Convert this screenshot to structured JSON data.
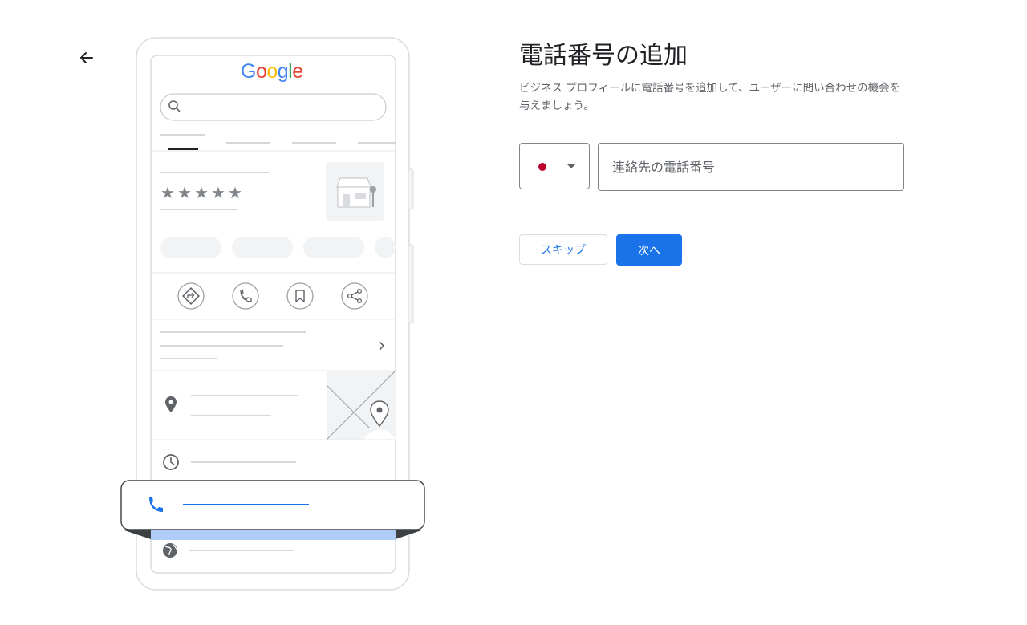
{
  "illustration": {
    "logo_letters": [
      {
        "char": "G",
        "color": "#4285F4"
      },
      {
        "char": "o",
        "color": "#EA4335"
      },
      {
        "char": "o",
        "color": "#FBBC05"
      },
      {
        "char": "g",
        "color": "#4285F4"
      },
      {
        "char": "l",
        "color": "#34A853"
      },
      {
        "char": "e",
        "color": "#EA4335"
      }
    ],
    "star_rating": 5,
    "highlight_color": "#1a73e8"
  },
  "header": {
    "title": "電話番号の追加",
    "description": "ビジネス プロフィールに電話番号を追加して、ユーザーに問い合わせの機会を与えましょう。"
  },
  "form": {
    "country_flag_color": "#bc002d",
    "phone_placeholder": "連絡先の電話番号",
    "phone_value": ""
  },
  "buttons": {
    "skip_label": "スキップ",
    "next_label": "次へ"
  }
}
